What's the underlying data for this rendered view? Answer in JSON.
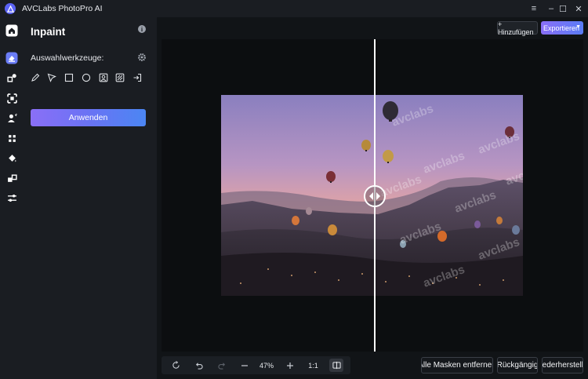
{
  "app": {
    "title": "AVCLabs PhotoPro AI",
    "window_controls": [
      "≡",
      "–",
      "☐",
      "✕"
    ]
  },
  "rail": {
    "items": [
      {
        "name": "home",
        "active": false
      },
      {
        "name": "inpaint",
        "active": true
      },
      {
        "name": "replace",
        "active": false
      },
      {
        "name": "upscale",
        "active": false
      },
      {
        "name": "remove-bg",
        "active": false
      },
      {
        "name": "enhance",
        "active": false
      },
      {
        "name": "colorize",
        "active": false
      },
      {
        "name": "compose",
        "active": false
      },
      {
        "name": "adjust",
        "active": false
      }
    ]
  },
  "panel": {
    "title": "Inpaint",
    "section_label": "Auswahlwerkzeuge:",
    "tools": [
      "brush",
      "lasso",
      "rectangle",
      "ellipse",
      "portrait",
      "hatch",
      "import"
    ],
    "apply_label": "Anwenden"
  },
  "topbar": {
    "add_label": "+ Hinzufügen",
    "export_label": "Exportieren"
  },
  "canvas": {
    "watermark": "avclabs",
    "split_position_percent": 50
  },
  "bottombar": {
    "zoom": "47%",
    "ratio": "1:1"
  },
  "actions": {
    "remove_masks": "Alle Masken entfernen",
    "undo": "Rückgängig",
    "redo": "Wiederherstellen"
  },
  "colors": {
    "accent_start": "#8a6ff7",
    "accent_end": "#4b86f3",
    "background": "#111417",
    "panel": "#1a1d22"
  }
}
